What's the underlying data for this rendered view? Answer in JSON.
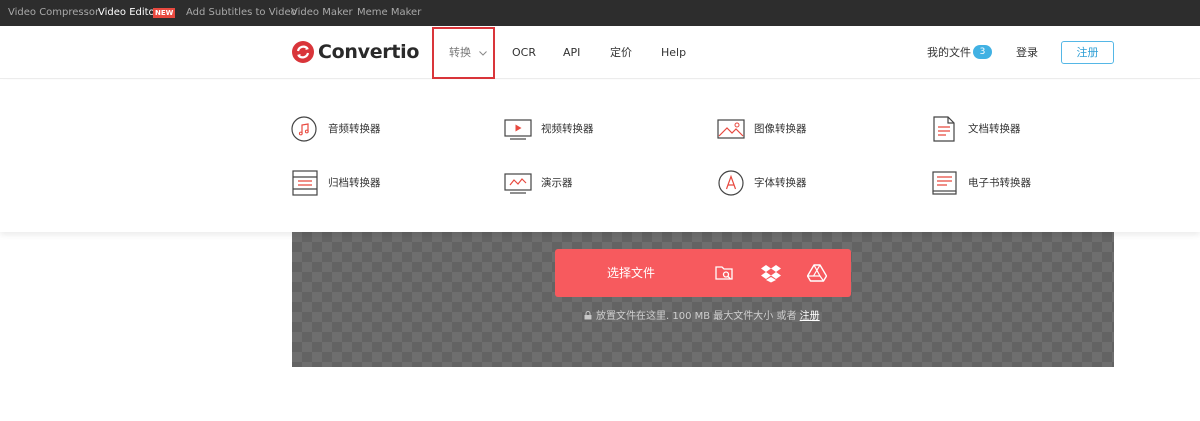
{
  "topbar": {
    "items": [
      "Video Compressor",
      "Video Editor",
      "Add Subtitles to Video",
      "Video Maker",
      "Meme Maker"
    ],
    "badge": "NEW"
  },
  "header": {
    "logo": "Convertio",
    "nav": {
      "convert": "转换",
      "ocr": "OCR",
      "api": "API",
      "pricing": "定价",
      "help": "Help"
    },
    "my_files": "我的文件",
    "my_files_count": "3",
    "login": "登录",
    "signup": "注册"
  },
  "dropdown": {
    "items": [
      {
        "label": "音频转换器",
        "icon": "music-icon"
      },
      {
        "label": "视频转换器",
        "icon": "video-icon"
      },
      {
        "label": "图像转换器",
        "icon": "image-icon"
      },
      {
        "label": "文档转换器",
        "icon": "document-icon"
      },
      {
        "label": "归档转换器",
        "icon": "archive-icon"
      },
      {
        "label": "演示器",
        "icon": "presentation-icon"
      },
      {
        "label": "字体转换器",
        "icon": "font-icon"
      },
      {
        "label": "电子书转换器",
        "icon": "ebook-icon"
      }
    ]
  },
  "upload": {
    "choose_label": "选择文件",
    "hint": "放置文件在这里. 100 MB 最大文件大小 或者",
    "hint_link": "注册"
  },
  "colors": {
    "accent": "#f75a5e",
    "brand_red": "#d9353a",
    "link_blue": "#41b1e3",
    "topbar_bg": "#2d2d2d"
  }
}
